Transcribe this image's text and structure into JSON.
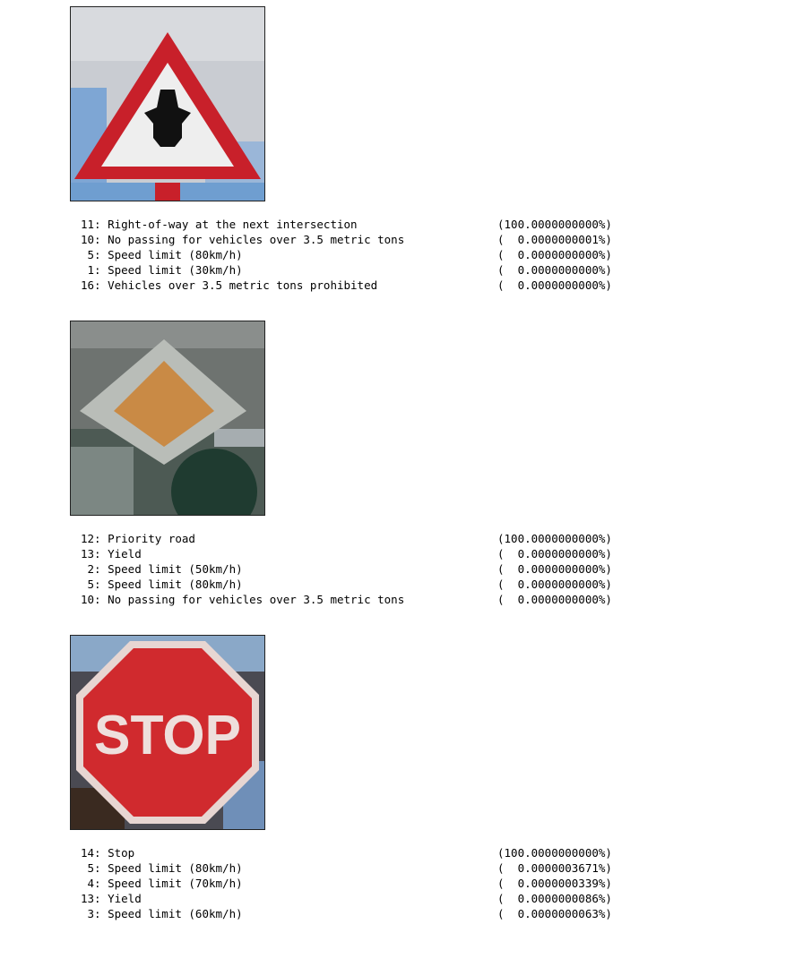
{
  "results": [
    {
      "image_name": "right-of-way-sign-image",
      "predictions": [
        {
          "label": "11: Right-of-way at the next intersection",
          "prob": "(100.0000000000%)"
        },
        {
          "label": "10: No passing for vehicles over 3.5 metric tons",
          "prob": "(  0.0000000001%)"
        },
        {
          "label": " 5: Speed limit (80km/h)",
          "prob": "(  0.0000000000%)"
        },
        {
          "label": " 1: Speed limit (30km/h)",
          "prob": "(  0.0000000000%)"
        },
        {
          "label": "16: Vehicles over 3.5 metric tons prohibited",
          "prob": "(  0.0000000000%)"
        }
      ]
    },
    {
      "image_name": "priority-road-sign-image",
      "predictions": [
        {
          "label": "12: Priority road",
          "prob": "(100.0000000000%)"
        },
        {
          "label": "13: Yield",
          "prob": "(  0.0000000000%)"
        },
        {
          "label": " 2: Speed limit (50km/h)",
          "prob": "(  0.0000000000%)"
        },
        {
          "label": " 5: Speed limit (80km/h)",
          "prob": "(  0.0000000000%)"
        },
        {
          "label": "10: No passing for vehicles over 3.5 metric tons",
          "prob": "(  0.0000000000%)"
        }
      ]
    },
    {
      "image_name": "stop-sign-image",
      "sign_text": "STOP",
      "predictions": [
        {
          "label": "14: Stop",
          "prob": "(100.0000000000%)"
        },
        {
          "label": " 5: Speed limit (80km/h)",
          "prob": "(  0.0000003671%)"
        },
        {
          "label": " 4: Speed limit (70km/h)",
          "prob": "(  0.0000000339%)"
        },
        {
          "label": "13: Yield",
          "prob": "(  0.0000000086%)"
        },
        {
          "label": " 3: Speed limit (60km/h)",
          "prob": "(  0.0000000063%)"
        }
      ]
    }
  ],
  "colors": {
    "sign_red": "#c8202a",
    "priority_orange": "#c98a45",
    "sky_blue": "#6f9ed0"
  }
}
